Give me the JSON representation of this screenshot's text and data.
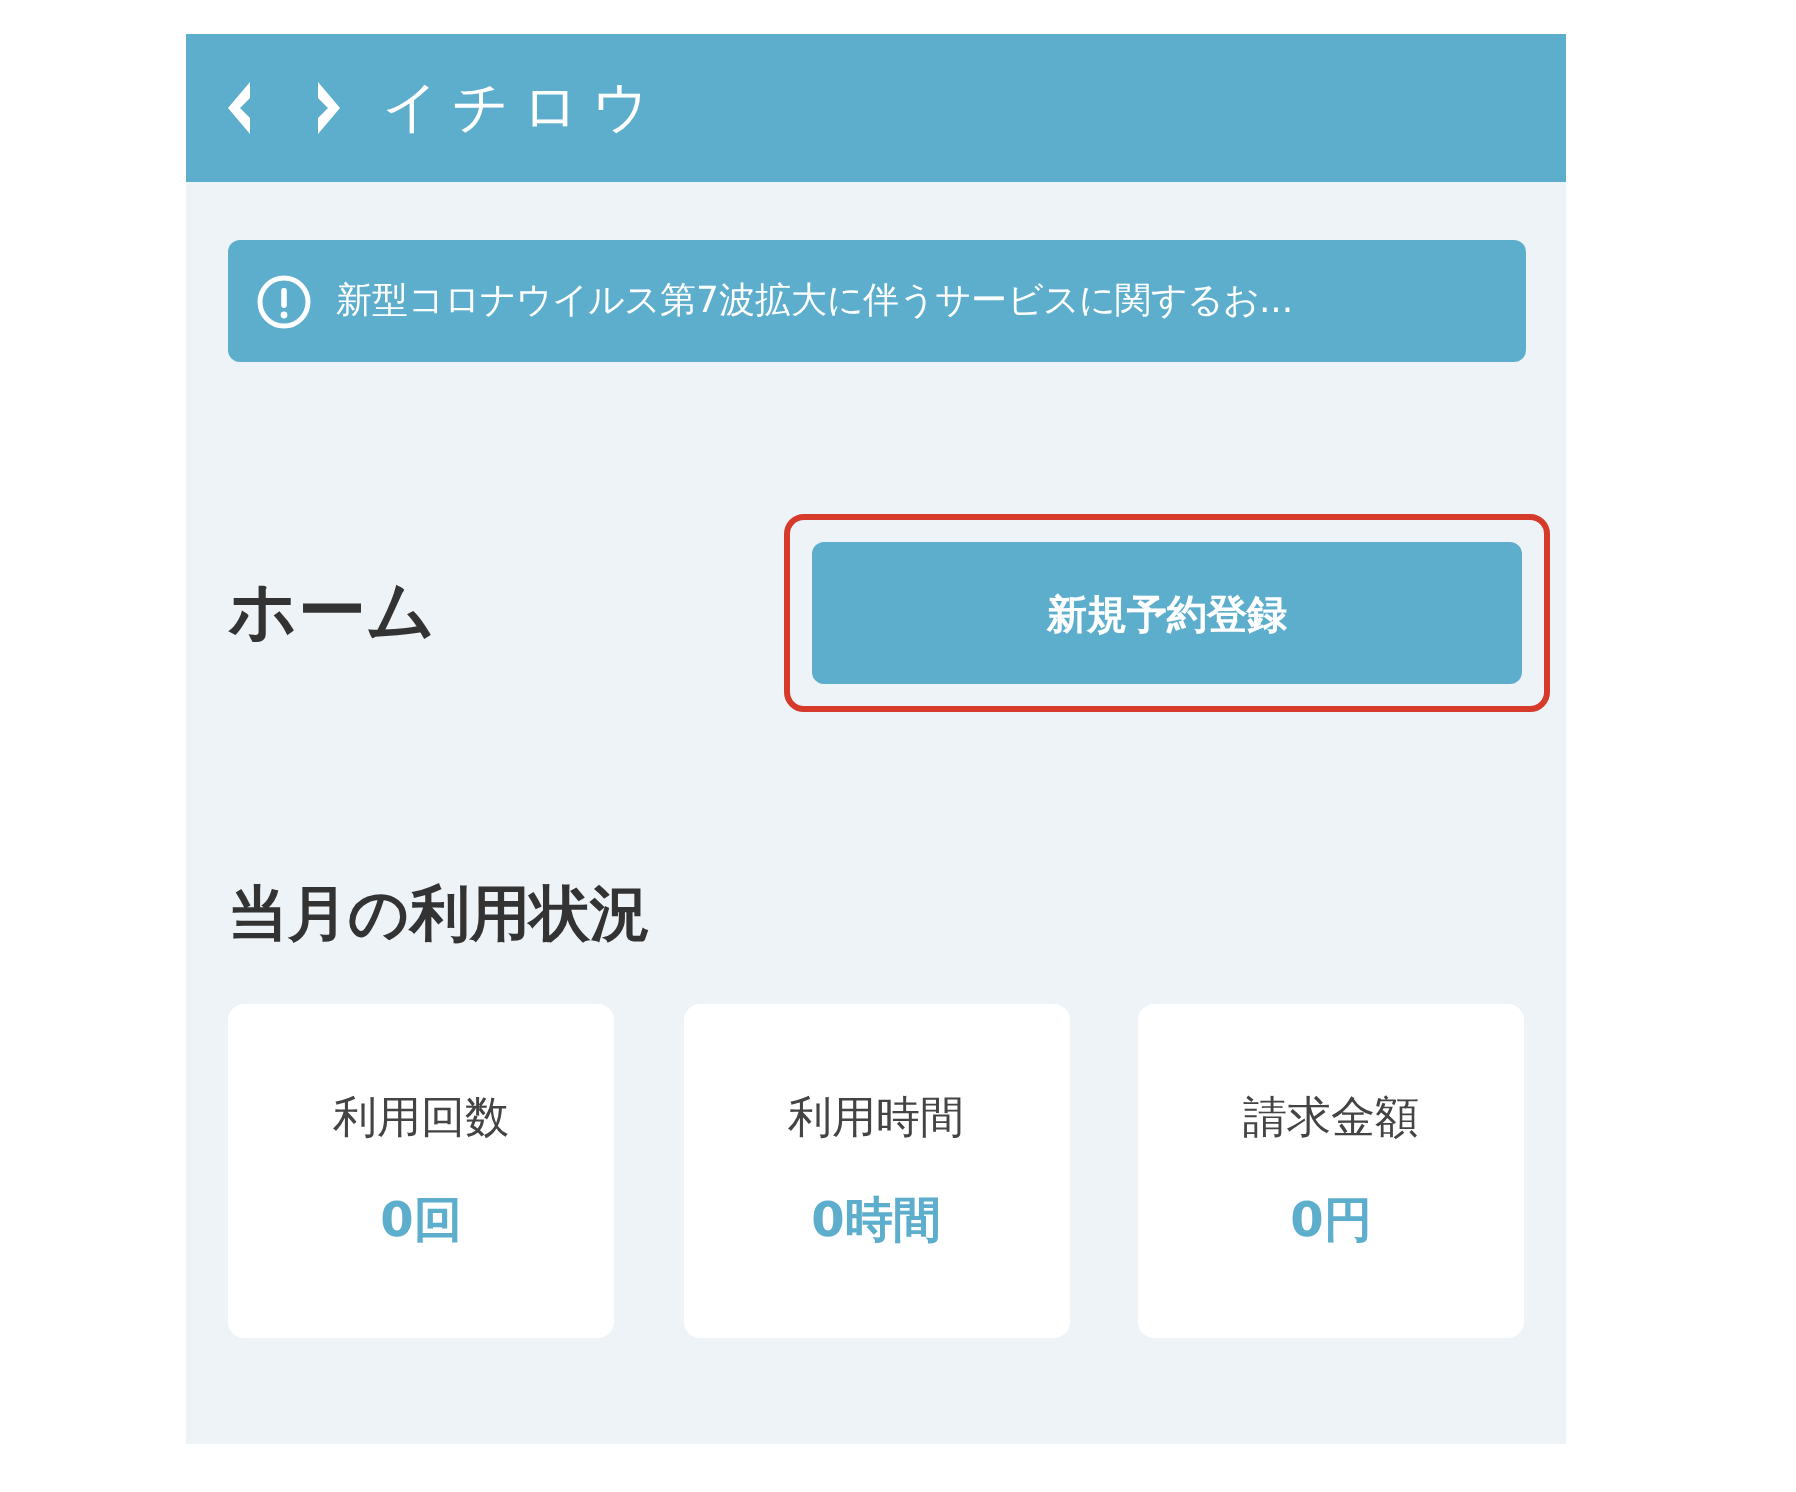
{
  "header": {
    "logo_text": "イチロウ"
  },
  "notice": {
    "text": "新型コロナウイルス第7波拡大に伴うサービスに関するお..."
  },
  "page_title": "ホーム",
  "new_booking_button": {
    "label": "新規予約登録",
    "highlighted": true
  },
  "usage_section": {
    "title": "当月の利用状況",
    "cards": [
      {
        "label": "利用回数",
        "value": "0回"
      },
      {
        "label": "利用時間",
        "value": "0時間"
      },
      {
        "label": "請求金額",
        "value": "0円"
      }
    ]
  }
}
